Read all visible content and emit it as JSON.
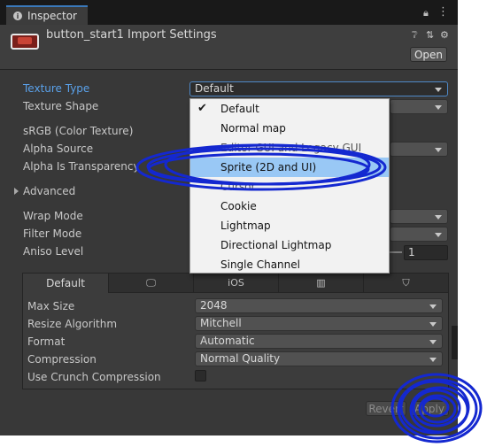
{
  "window": {
    "tab_title": "Inspector",
    "asset_title": "button_start1 Import Settings",
    "open_label": "Open"
  },
  "fields": {
    "texture_type": {
      "label": "Texture Type",
      "value": "Default"
    },
    "texture_shape": {
      "label": "Texture Shape"
    },
    "srgb": {
      "label": "sRGB (Color Texture)"
    },
    "alpha_source": {
      "label": "Alpha Source"
    },
    "alpha_is_transparency": {
      "label": "Alpha Is Transparency"
    },
    "advanced": {
      "label": "Advanced"
    },
    "wrap_mode": {
      "label": "Wrap Mode"
    },
    "filter_mode": {
      "label": "Filter Mode"
    },
    "aniso_level": {
      "label": "Aniso Level",
      "value": "1"
    }
  },
  "dropdown_menu": {
    "items": [
      {
        "label": "Default",
        "checked": true
      },
      {
        "label": "Normal map"
      },
      {
        "label": "Editor GUI and Legacy GUI"
      },
      {
        "label": "Sprite (2D and UI)",
        "highlighted": true
      },
      {
        "label": "Cursor"
      },
      {
        "label": "Cookie"
      },
      {
        "label": "Lightmap"
      },
      {
        "label": "Directional Lightmap"
      },
      {
        "label": "Single Channel"
      }
    ]
  },
  "platform": {
    "tabs": [
      {
        "label": "Default",
        "icon": "default-tab"
      },
      {
        "label": "",
        "icon": "monitor-icon"
      },
      {
        "label": "iOS",
        "icon": "ios-tab"
      },
      {
        "label": "",
        "icon": "android-icon"
      },
      {
        "label": "",
        "icon": "webgl-icon"
      }
    ],
    "max_size": {
      "label": "Max Size",
      "value": "2048"
    },
    "resize_algorithm": {
      "label": "Resize Algorithm",
      "value": "Mitchell"
    },
    "format": {
      "label": "Format",
      "value": "Automatic"
    },
    "compression": {
      "label": "Compression",
      "value": "Normal Quality"
    },
    "use_crunch": {
      "label": "Use Crunch Compression",
      "checked": false
    }
  },
  "buttons": {
    "revert": "Revert",
    "apply": "Apply"
  },
  "colors": {
    "panel_bg": "#383838",
    "label_accent": "#5aa1ea",
    "menu_highlight": "#99c8f5",
    "ink_annotation": "#1428d0"
  }
}
